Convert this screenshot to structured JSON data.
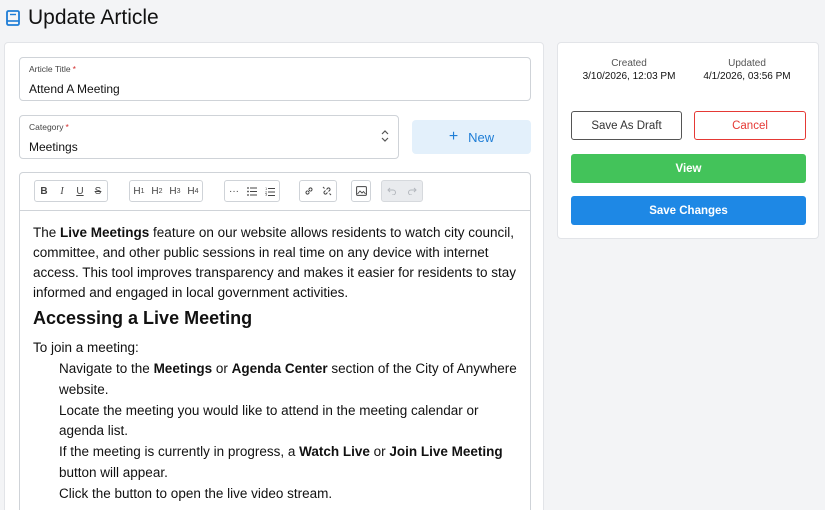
{
  "header": {
    "title": "Update Article",
    "icon": "book-icon"
  },
  "form": {
    "title_label": "Article Title",
    "title_value": "Attend A Meeting",
    "category_label": "Category",
    "category_value": "Meetings",
    "required_mark": "*",
    "new_button_label": "New"
  },
  "toolbar": {
    "bold": "B",
    "italic": "I",
    "underline": "U",
    "strike": "S",
    "h1": "H",
    "h2": "H",
    "h3": "H",
    "h4": "H",
    "h1n": "1",
    "h2n": "2",
    "h3n": "3",
    "h4n": "4",
    "more": "···",
    "bullet": "☰",
    "ordered": "☷",
    "link": "🔗",
    "unlink": "⛓",
    "image": "🖼",
    "undo": "↶",
    "redo": "↷"
  },
  "content": {
    "intro_pre": "The ",
    "intro_bold": "Live Meetings",
    "intro_post": " feature on our website allows residents to watch city council, committee, and other public sessions in real time on any device with internet access. This tool improves transparency and makes it easier for residents to stay informed and engaged in local government activities.",
    "heading": "Accessing a Live Meeting",
    "join": "To join a meeting:",
    "step1_pre": "Navigate to the ",
    "step1_b1": "Meetings",
    "step1_mid": " or ",
    "step1_b2": "Agenda Center",
    "step1_post": " section of the City of Anywhere website.",
    "step2": "Locate the meeting you would like to attend in the meeting calendar or agenda list.",
    "step3_pre": "If the meeting is currently in progress, a ",
    "step3_b1": "Watch Live",
    "step3_mid": " or ",
    "step3_b2": "Join Live Meeting",
    "step3_post": " button will appear.",
    "step4": "Click the button to open the live video stream."
  },
  "meta": {
    "created_label": "Created",
    "created_value": "3/10/2026, 12:03 PM",
    "updated_label": "Updated",
    "updated_value": "4/1/2026, 03:56 PM"
  },
  "actions": {
    "draft_label": "Save As Draft",
    "cancel_label": "Cancel",
    "view_label": "View",
    "save_label": "Save Changes"
  },
  "colors": {
    "accent": "#1e88e5",
    "success": "#43c35a",
    "danger": "#e53935"
  }
}
